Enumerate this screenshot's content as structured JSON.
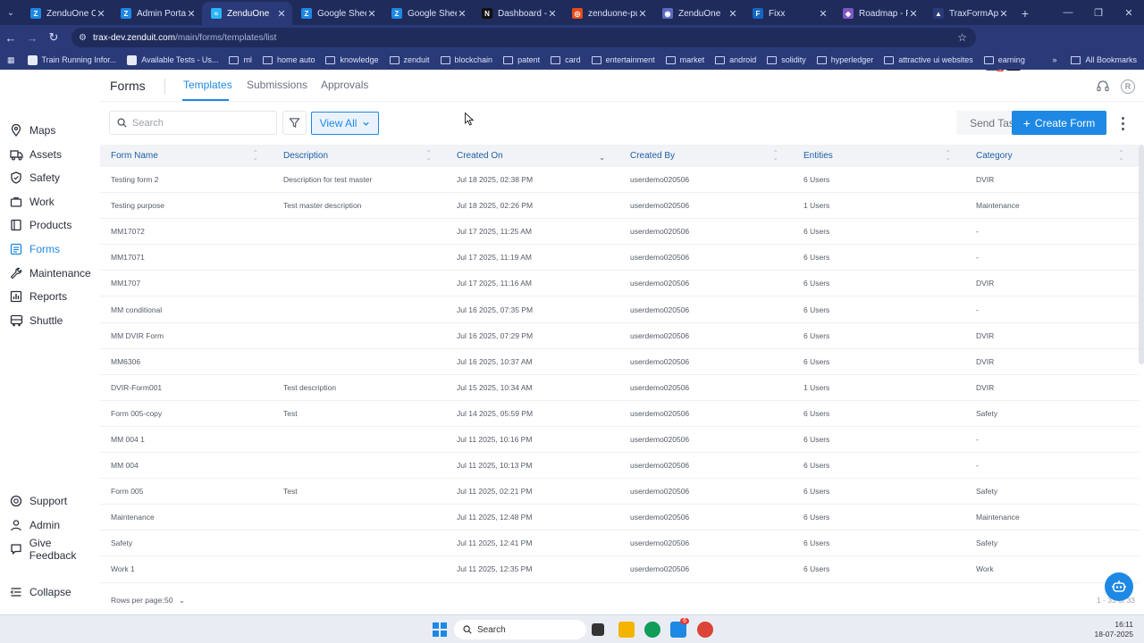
{
  "browser": {
    "tabs": [
      {
        "label": "ZenduOne Co",
        "fav": "Z",
        "color": "#1e88e5"
      },
      {
        "label": "Admin Portal",
        "fav": "Z",
        "color": "#1e88e5"
      },
      {
        "label": "ZenduOne",
        "fav": "≈",
        "color": "#29b6f6"
      },
      {
        "label": "Google Sheets",
        "fav": "Z",
        "color": "#1e88e5"
      },
      {
        "label": "Google Sheets",
        "fav": "Z",
        "color": "#1e88e5"
      },
      {
        "label": "Dashboard - N",
        "fav": "N",
        "color": "#111111"
      },
      {
        "label": "zenduone-pub",
        "fav": "◎",
        "color": "#e64a19"
      },
      {
        "label": "ZenduOne",
        "fav": "◉",
        "color": "#5c6bc0"
      },
      {
        "label": "Fixx",
        "fav": "F",
        "color": "#1565c0"
      },
      {
        "label": "Roadmap - Fe",
        "fav": "◈",
        "color": "#7e57c2"
      },
      {
        "label": "TraxFormApp",
        "fav": "▲",
        "color": "#2a3a78"
      }
    ],
    "active_tab": 2,
    "url_host": "trax-dev.zenduit.com",
    "url_path": "/main/forms/templates/list",
    "bookmarks": [
      {
        "label": "Train Running Infor...",
        "type": "fav"
      },
      {
        "label": "Available Tests - Us...",
        "type": "fav"
      },
      {
        "label": "ml",
        "type": "folder"
      },
      {
        "label": "home auto",
        "type": "folder"
      },
      {
        "label": "knowledge",
        "type": "folder"
      },
      {
        "label": "zenduit",
        "type": "folder"
      },
      {
        "label": "blockchain",
        "type": "folder"
      },
      {
        "label": "patent",
        "type": "folder"
      },
      {
        "label": "card",
        "type": "folder"
      },
      {
        "label": "entertainment",
        "type": "folder"
      },
      {
        "label": "market",
        "type": "folder"
      },
      {
        "label": "android",
        "type": "folder"
      },
      {
        "label": "solidity",
        "type": "folder"
      },
      {
        "label": "hyperledger",
        "type": "folder"
      },
      {
        "label": "attractive ui websites",
        "type": "folder"
      },
      {
        "label": "earning",
        "type": "folder"
      }
    ],
    "more_bookmarks": "»",
    "all_bookmarks": "All Bookmarks",
    "ext_badge": "1"
  },
  "sidebar": {
    "items": [
      {
        "label": "Maps",
        "icon": "map-pin-icon"
      },
      {
        "label": "Assets",
        "icon": "truck-icon"
      },
      {
        "label": "Safety",
        "icon": "shield-icon"
      },
      {
        "label": "Work",
        "icon": "briefcase-icon"
      },
      {
        "label": "Products",
        "icon": "package-icon"
      },
      {
        "label": "Forms",
        "icon": "list-icon",
        "active": true
      },
      {
        "label": "Maintenance",
        "icon": "wrench-icon"
      },
      {
        "label": "Reports",
        "icon": "report-icon"
      },
      {
        "label": "Shuttle",
        "icon": "bus-icon"
      }
    ],
    "bottom": [
      {
        "label": "Support",
        "icon": "support-icon"
      },
      {
        "label": "Admin",
        "icon": "user-icon"
      },
      {
        "label": "Give Feedback",
        "icon": "feedback-icon"
      },
      {
        "label": "Collapse",
        "icon": "collapse-icon"
      }
    ]
  },
  "header": {
    "title": "Forms",
    "tabs": [
      "Templates",
      "Submissions",
      "Approvals"
    ],
    "active_tab": "Templates",
    "avatar": "R"
  },
  "toolbar": {
    "search_placeholder": "Search",
    "view_all": "View All",
    "send_task": "Send Task",
    "create_form": "Create Form"
  },
  "table": {
    "columns": [
      "Form Name",
      "Description",
      "Created On",
      "Created By",
      "Entities",
      "Category"
    ],
    "rows": [
      [
        "Testing form 2",
        "Description for test master",
        "Jul 18 2025, 02:38 PM",
        "userdemo020506",
        "6 Users",
        "DVIR"
      ],
      [
        "Testing purpose",
        "Test master description",
        "Jul 18 2025, 02:26 PM",
        "userdemo020506",
        "1 Users",
        "Maintenance"
      ],
      [
        "MM17072",
        "",
        "Jul 17 2025, 11:25 AM",
        "userdemo020506",
        "6 Users",
        "-"
      ],
      [
        "MM17071",
        "",
        "Jul 17 2025, 11:19 AM",
        "userdemo020506",
        "6 Users",
        "-"
      ],
      [
        "MM1707",
        "",
        "Jul 17 2025, 11:16 AM",
        "userdemo020506",
        "6 Users",
        "DVIR"
      ],
      [
        "MM conditional",
        "",
        "Jul 16 2025, 07:35 PM",
        "userdemo020506",
        "6 Users",
        "-"
      ],
      [
        "MM DVIR Form",
        "",
        "Jul 16 2025, 07:29 PM",
        "userdemo020506",
        "6 Users",
        "DVIR"
      ],
      [
        "MM6306",
        "",
        "Jul 16 2025, 10:37 AM",
        "userdemo020506",
        "6 Users",
        "DVIR"
      ],
      [
        "DVIR-Form001",
        "Test description",
        "Jul 15 2025, 10:34 AM",
        "userdemo020506",
        "1 Users",
        "DVIR"
      ],
      [
        "Form 005-copy",
        "Test",
        "Jul 14 2025, 05:59 PM",
        "userdemo020506",
        "6 Users",
        "Safety"
      ],
      [
        "MM 004 1",
        "",
        "Jul 11 2025, 10:16 PM",
        "userdemo020506",
        "6 Users",
        "-"
      ],
      [
        "MM 004",
        "",
        "Jul 11 2025, 10:13 PM",
        "userdemo020506",
        "6 Users",
        "-"
      ],
      [
        "Form 005",
        "Test",
        "Jul 11 2025, 02:21 PM",
        "userdemo020506",
        "6 Users",
        "Safety"
      ],
      [
        "Maintenance",
        "",
        "Jul 11 2025, 12:48 PM",
        "userdemo020506",
        "6 Users",
        "Maintenance"
      ],
      [
        "Safety",
        "",
        "Jul 11 2025, 12:41 PM",
        "userdemo020506",
        "6 Users",
        "Safety"
      ],
      [
        "Work 1",
        "",
        "Jul 11 2025, 12:35 PM",
        "userdemo020506",
        "6 Users",
        "Work"
      ]
    ]
  },
  "footer": {
    "rows_per_page_label": "Rows per page:",
    "rows_per_page": "50",
    "pager": "1 - 33 of 33"
  },
  "taskbar": {
    "search": "Search",
    "time": "16:11",
    "date": "18-07-2025",
    "notif_badge": "6"
  },
  "colors": {
    "accent": "#1e88e5",
    "browser_frame": "#2a3a78",
    "browser_tabbar": "#1f2b5b"
  }
}
